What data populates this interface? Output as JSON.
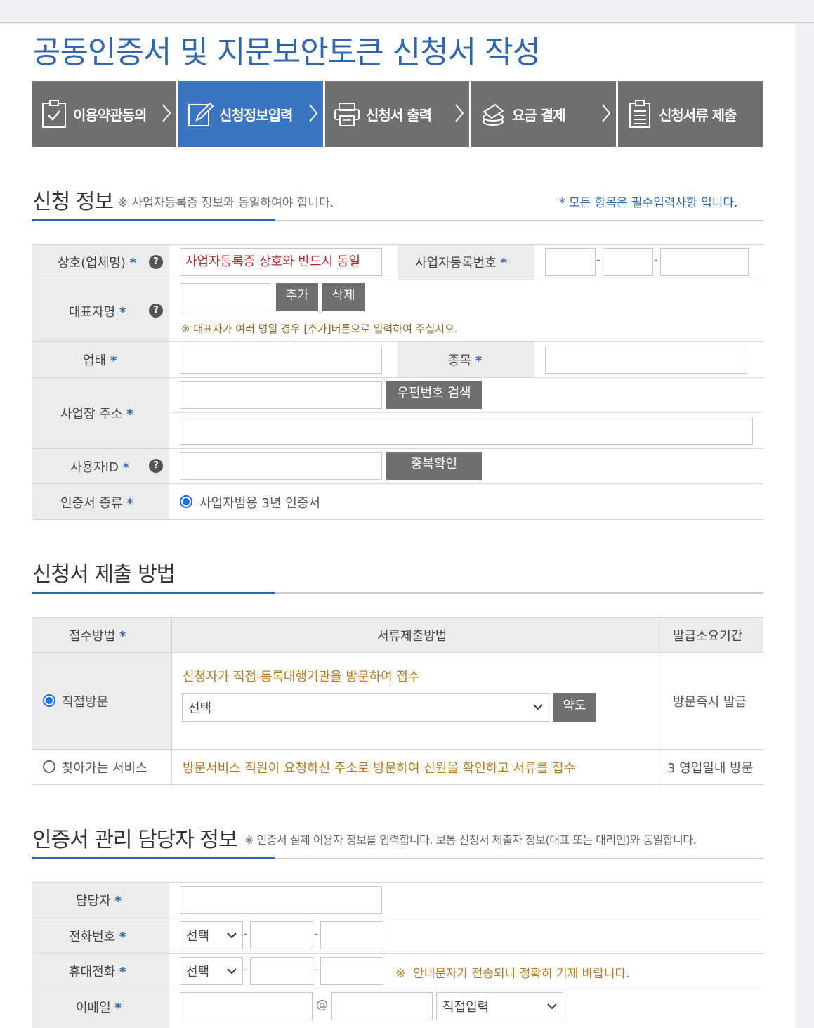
{
  "page_title": "공동인증서 및 지문보안토큰 신청서 작성",
  "steps": [
    {
      "label": "이용약관동의",
      "icon": "clipboard-check-icon",
      "active": false
    },
    {
      "label": "신청정보입력",
      "icon": "pencil-edit-icon",
      "active": true
    },
    {
      "label": "신청서 출력",
      "icon": "printer-icon",
      "active": false
    },
    {
      "label": "요금 결제",
      "icon": "coins-icon",
      "active": false
    },
    {
      "label": "신청서류 제출",
      "icon": "document-list-icon",
      "active": false
    }
  ],
  "apply_info": {
    "title": "신청 정보",
    "note_mark": "※",
    "note": "사업자등록증 정보와 동일하여야 합니다.",
    "required_note": "* 모든 항목은 필수입력사항 입니다.",
    "star": "*",
    "help": "?",
    "company_label": "상호(업체명)",
    "company_placeholder": "사업자등록증 상호와 반드시 동일",
    "bizno_label": "사업자등록번호",
    "dash": "-",
    "ceo_label": "대표자명",
    "add_button": "추가",
    "delete_button": "삭제",
    "ceo_hint": "※ 대표자가 여러 명일 경우 [추가]버튼으로 입력하여 주십시오.",
    "biztype_label": "업태",
    "bizitem_label": "종목",
    "address_label": "사업장 주소",
    "zip_button": "우편번호 검색",
    "userid_label": "사용자ID",
    "dup_button": "중복확인",
    "certtype_label": "인증서 종류",
    "certtype_option": "사업자범용 3년 인증서"
  },
  "submit_method": {
    "title": "신청서 제출 방법",
    "headers": [
      "접수방법",
      "서류제출방법",
      "발급소요기간"
    ],
    "star": "*",
    "rows": [
      {
        "method": "직접방문",
        "selected": true,
        "desc": "신청자가 직접 등록대행기관을 방문하여 접수",
        "select_value": "선택",
        "map_button": "약도",
        "period": "방문즉시 발급"
      },
      {
        "method": "찾아가는 서비스",
        "selected": false,
        "desc": "방문서비스 직원이 요청하신 주소로 방문하여 신원을 확인하고 서류를 접수",
        "period": "3 영업일내 방문"
      }
    ]
  },
  "manager_info": {
    "title": "인증서 관리 담당자 정보",
    "note": "※ 인증서 실제 이용자 정보를 입력합니다. 보통 신청서 제출자 정보(대표 또는 대리인)와 동일합니다.",
    "star": "*",
    "dash": "-",
    "at": "@",
    "name_label": "담당자",
    "phone_label": "전화번호",
    "phone_select": "선택",
    "mobile_label": "휴대전화",
    "mobile_select": "선택",
    "mobile_hint_mark": "※",
    "mobile_hint": "안내문자가 전송되니 정확히 기재 바랍니다.",
    "email_label": "이메일",
    "email_domain_select": "직접입력"
  },
  "colors": {
    "accent": "#2f66ad",
    "step_active": "#3b74c0",
    "step_inactive": "#6f6f6f",
    "hint": "#b87a1e"
  }
}
